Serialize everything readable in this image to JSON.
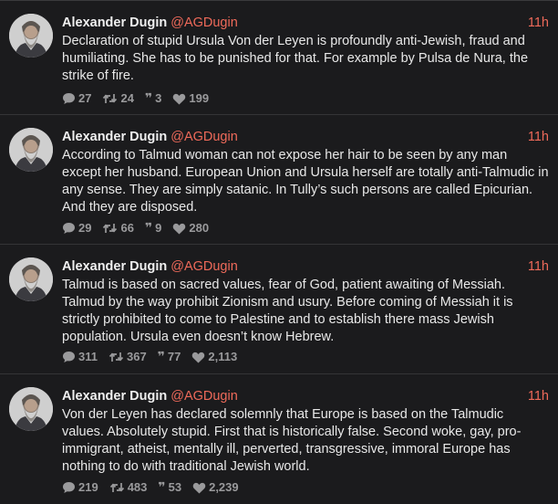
{
  "colors": {
    "background": "#1b1b1d",
    "accent": "#ef6a5a",
    "muted": "#9a9a9c"
  },
  "icons": {
    "reply": "speech-bubble",
    "repost": "repost-arrows",
    "quote": "quote-marks",
    "like": "heart"
  },
  "posts": [
    {
      "author": "Alexander Dugin",
      "handle": "@AGDugin",
      "time": "11h",
      "text": "Declaration of stupid Ursula Von der Leyen is profoundly anti-Jewish, fraud and humiliating. She has to be punished for that. For example by Pulsa de Nura, the strike of fire.",
      "replies": "27",
      "reposts": "24",
      "quotes": "3",
      "likes": "199"
    },
    {
      "author": "Alexander Dugin",
      "handle": "@AGDugin",
      "time": "11h",
      "text": "According to Talmud woman can not expose her hair to be seen by any man except her husband. European Union and Ursula herself are totally anti-Talmudic in any sense. They are simply satanic. In Tully’s such persons are called Epicurian. And they are disposed.",
      "replies": "29",
      "reposts": "66",
      "quotes": "9",
      "likes": "280"
    },
    {
      "author": "Alexander Dugin",
      "handle": "@AGDugin",
      "time": "11h",
      "text": "Talmud is based on sacred values, fear of God, patient awaiting of Messiah. Talmud by the way prohibit Zionism and usury. Before coming of Messiah it is strictly prohibited to come to Palestine and to establish there mass Jewish population. Ursula even doesn’t know Hebrew.",
      "replies": "311",
      "reposts": "367",
      "quotes": "77",
      "likes": "2,113"
    },
    {
      "author": "Alexander Dugin",
      "handle": "@AGDugin",
      "time": "11h",
      "text": "Von der Leyen has declared solemnly that Europe is based on the Talmudic values. Absolutely stupid. First that is historically false. Second woke, gay, pro-immigrant, atheist, mentally ill, perverted, transgressive, immoral Europe has nothing to do with traditional Jewish world.",
      "replies": "219",
      "reposts": "483",
      "quotes": "53",
      "likes": "2,239"
    }
  ]
}
